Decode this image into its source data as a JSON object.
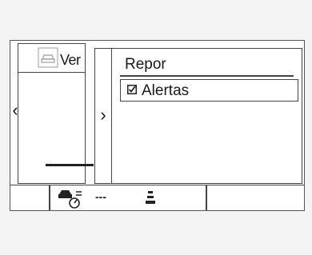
{
  "back_panel": {
    "title": "Ver"
  },
  "menu": {
    "items": [
      {
        "label": "Repor"
      },
      {
        "label": "Alertas",
        "checked": true
      }
    ]
  },
  "status": {
    "dashes": "---"
  },
  "icons": [
    "car-icon",
    "chevron-left-icon",
    "chevron-right-icon",
    "checkbox-icon",
    "car-gauge-icon",
    "lane-icon"
  ]
}
